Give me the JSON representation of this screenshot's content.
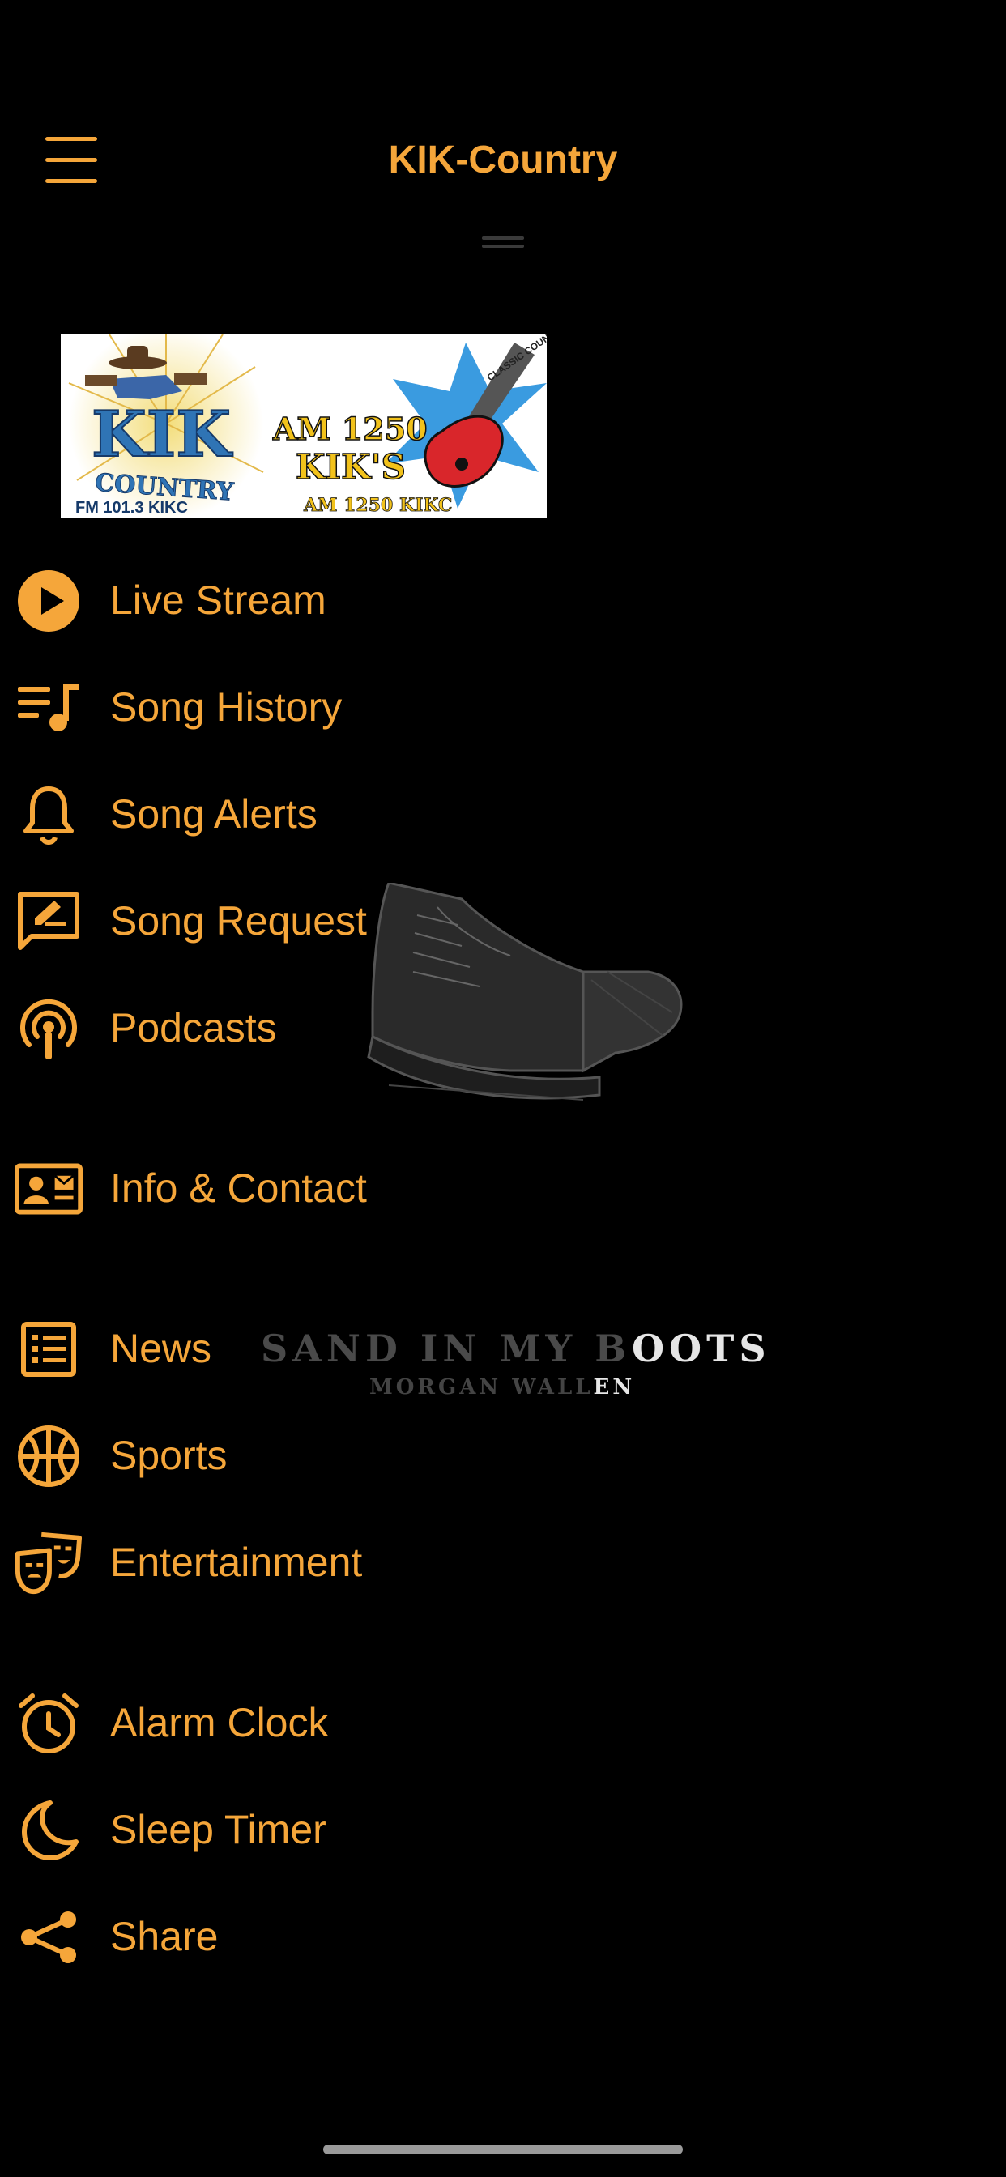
{
  "header": {
    "title": "KIK-Country",
    "menu_icon": "hamburger-icon"
  },
  "logo": {
    "left": {
      "line1": "KIK",
      "line2": "COUNTRY",
      "line3": "FM 101.3 KIKC"
    },
    "right": {
      "badge": "CLASSIC COUNTRY",
      "line1": "AM 1250",
      "line2": "KIK'S",
      "line3": "AM 1250 KIKC"
    }
  },
  "menu": {
    "items": [
      {
        "label": "Live Stream",
        "icon": "play-circle-icon"
      },
      {
        "label": "Song History",
        "icon": "playlist-icon"
      },
      {
        "label": "Song Alerts",
        "icon": "bell-icon"
      },
      {
        "label": "Song Request",
        "icon": "request-edit-icon"
      },
      {
        "label": "Podcasts",
        "icon": "podcast-icon"
      },
      {
        "label": "Info & Contact",
        "icon": "contact-card-icon"
      },
      {
        "label": "News",
        "icon": "news-icon"
      },
      {
        "label": "Sports",
        "icon": "basketball-icon"
      },
      {
        "label": "Entertainment",
        "icon": "theater-masks-icon"
      },
      {
        "label": "Alarm Clock",
        "icon": "alarm-clock-icon"
      },
      {
        "label": "Sleep Timer",
        "icon": "moon-icon"
      },
      {
        "label": "Share",
        "icon": "share-icon"
      }
    ]
  },
  "now_playing": {
    "title_dim": "SAND IN MY B",
    "title_bright": "OOTS",
    "artist_dim": "MORGAN WALL",
    "artist_bright": "EN"
  },
  "colors": {
    "accent": "#F5A63A",
    "background": "#000000"
  }
}
